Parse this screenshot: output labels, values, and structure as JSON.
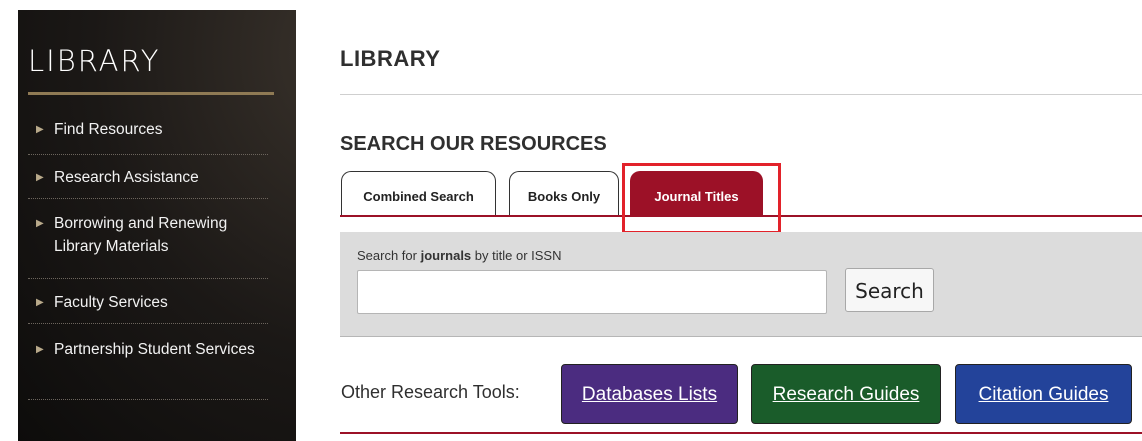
{
  "sidebar": {
    "title": "LIBRARY",
    "items": [
      {
        "label": "Find Resources"
      },
      {
        "label": "Research Assistance"
      },
      {
        "label": "Borrowing and Renewing Library Materials"
      },
      {
        "label": "Faculty Services"
      },
      {
        "label": "Partnership Student Services"
      }
    ]
  },
  "main": {
    "page_title": "LIBRARY",
    "section_title": "SEARCH OUR RESOURCES",
    "tabs": [
      {
        "label": "Combined Search",
        "active": false
      },
      {
        "label": "Books Only",
        "active": false
      },
      {
        "label": "Journal Titles",
        "active": true
      }
    ],
    "search": {
      "label_prefix": "Search for ",
      "label_bold": "journals",
      "label_suffix": " by title or ISSN",
      "value": "",
      "button_label": "Search"
    },
    "other_tools": {
      "label": "Other Research Tools:",
      "buttons": [
        {
          "label": "Databases Lists",
          "bg": "#4b2c80",
          "text": "#ffffff"
        },
        {
          "label": "Research Guides",
          "bg": "#1a5c2a",
          "text": "#ffffff"
        },
        {
          "label": "Citation Guides",
          "bg": "#23439a",
          "text": "#ffffff"
        }
      ]
    }
  },
  "colors": {
    "accent": "#9c1127",
    "highlight": "#e2222a"
  }
}
